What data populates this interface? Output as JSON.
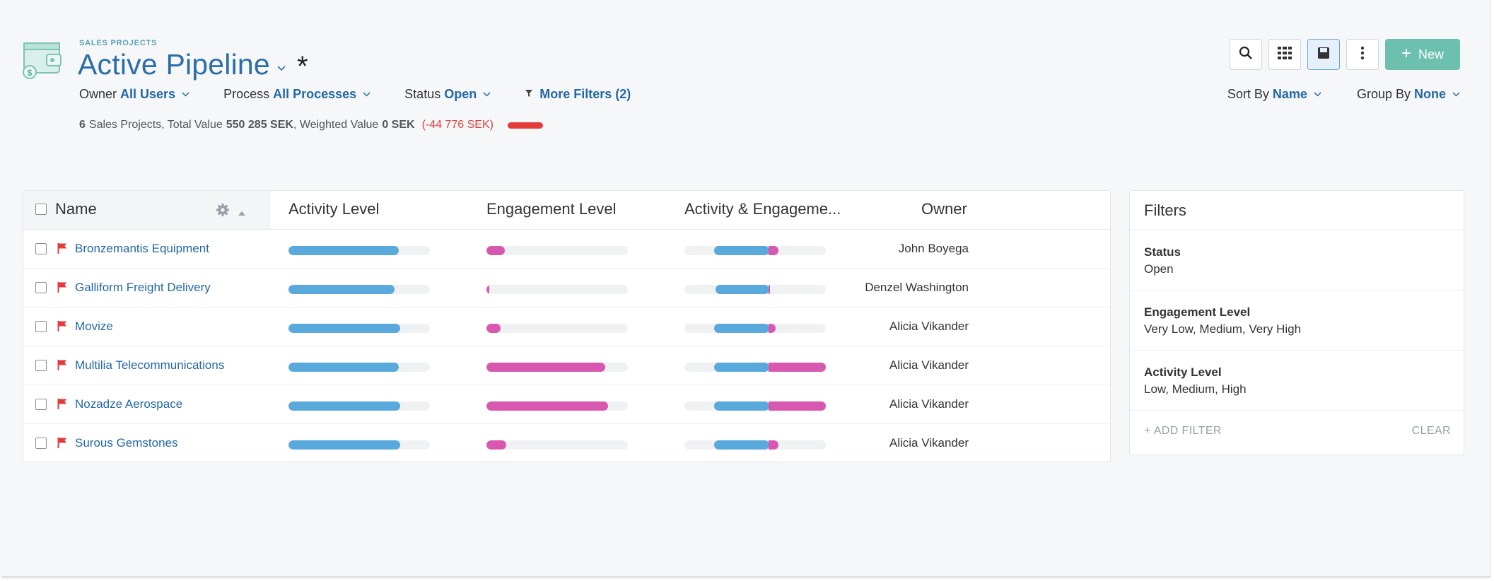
{
  "header": {
    "breadcrumb": "SALES PROJECTS",
    "title": "Active Pipeline",
    "unsaved_marker": "*",
    "caret_icon": "chevron-down-icon"
  },
  "filters": {
    "owner_label": "Owner",
    "owner_value": "All Users",
    "process_label": "Process",
    "process_value": "All Processes",
    "status_label": "Status",
    "status_value": "Open",
    "more_filters": "More Filters (2)"
  },
  "summary": {
    "count": "6",
    "count_text": "Sales Projects, Total Value",
    "total_value": "550 285 SEK",
    "weighted_text": ", Weighted Value",
    "weighted_value": "0 SEK",
    "difference": "(-44 776 SEK)"
  },
  "toolbar": {
    "new_label": "New",
    "icons": [
      "search-icon",
      "grid-icon",
      "save-icon",
      "more-vertical-icon"
    ]
  },
  "sort": {
    "sort_label": "Sort By",
    "sort_value": "Name",
    "group_label": "Group By",
    "group_value": "None"
  },
  "table": {
    "columns": {
      "name": "Name",
      "activity": "Activity Level",
      "engagement": "Engagement Level",
      "combined": "Activity & Engageme...",
      "owner": "Owner"
    },
    "colors": {
      "activity": "#5aa9dd",
      "engagement": "#d858b0",
      "flag": "#e23b3b"
    },
    "rows": [
      {
        "name": "Bronzemantis Equipment",
        "owner": "John Boyega",
        "activity": 0.78,
        "engagement": 0.13,
        "combined_activity": 0.39,
        "combined_engagement": 0.07
      },
      {
        "name": "Galliform Freight Delivery",
        "owner": "Denzel Washington",
        "activity": 0.75,
        "engagement": 0.02,
        "combined_activity": 0.38,
        "combined_engagement": 0.01
      },
      {
        "name": "Movize",
        "owner": "Alicia Vikander",
        "activity": 0.79,
        "engagement": 0.1,
        "combined_activity": 0.39,
        "combined_engagement": 0.05
      },
      {
        "name": "Multilia Telecommunications",
        "owner": "Alicia Vikander",
        "activity": 0.78,
        "engagement": 0.84,
        "combined_activity": 0.39,
        "combined_engagement": 0.42
      },
      {
        "name": "Nozadze Aerospace",
        "owner": "Alicia Vikander",
        "activity": 0.79,
        "engagement": 0.86,
        "combined_activity": 0.39,
        "combined_engagement": 0.43
      },
      {
        "name": "Surous Gemstones",
        "owner": "Alicia Vikander",
        "activity": 0.79,
        "engagement": 0.14,
        "combined_activity": 0.39,
        "combined_engagement": 0.07
      }
    ]
  },
  "filters_panel": {
    "title": "Filters",
    "sections": [
      {
        "label": "Status",
        "value": "Open"
      },
      {
        "label": "Engagement Level",
        "value": "Very Low, Medium, Very High"
      },
      {
        "label": "Activity Level",
        "value": "Low, Medium, High"
      }
    ],
    "add_filter": "+ ADD FILTER",
    "clear": "CLEAR"
  }
}
